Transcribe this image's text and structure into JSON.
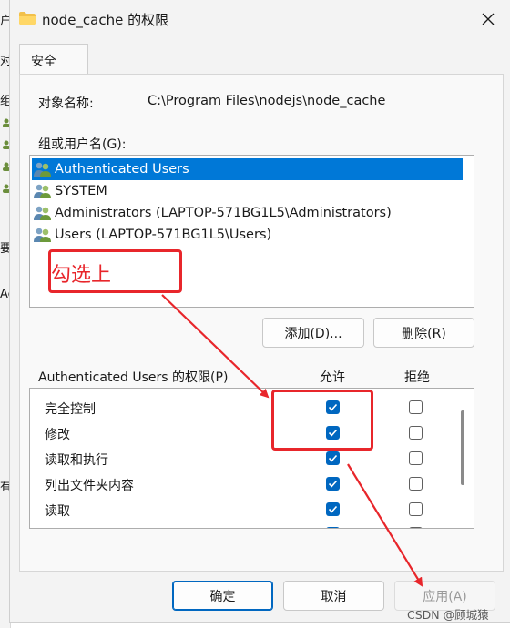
{
  "background_window": {
    "fragments": [
      "户",
      "对",
      "组",
      "要",
      "Ac",
      "有"
    ]
  },
  "window": {
    "title": "node_cache 的权限",
    "icon": "folder-icon",
    "close_icon": "close-icon"
  },
  "tab": {
    "label": "安全"
  },
  "object": {
    "label": "对象名称:",
    "value": "C:\\Program Files\\nodejs\\node_cache"
  },
  "groups": {
    "label": "组或用户名(G):",
    "items": [
      {
        "name": "Authenticated Users",
        "icon": "users-group-icon",
        "selected": true
      },
      {
        "name": "SYSTEM",
        "icon": "users-group-icon",
        "selected": false
      },
      {
        "name": "Administrators (LAPTOP-571BG1L5\\Administrators)",
        "icon": "users-group-icon",
        "selected": false
      },
      {
        "name": "Users (LAPTOP-571BG1L5\\Users)",
        "icon": "users-group-icon",
        "selected": false
      }
    ],
    "add_button": "添加(D)...",
    "remove_button": "删除(R)"
  },
  "permissions": {
    "label": "Authenticated Users 的权限(P)",
    "allow_header": "允许",
    "deny_header": "拒绝",
    "rows": [
      {
        "name": "完全控制",
        "allow": true,
        "deny": false
      },
      {
        "name": "修改",
        "allow": true,
        "deny": false
      },
      {
        "name": "读取和执行",
        "allow": true,
        "deny": false
      },
      {
        "name": "列出文件夹内容",
        "allow": true,
        "deny": false
      },
      {
        "name": "读取",
        "allow": true,
        "deny": false
      }
    ]
  },
  "footer": {
    "ok": "确定",
    "cancel": "取消",
    "apply": "应用(A)"
  },
  "annotation": {
    "text": "勾选上",
    "color": "#e8262b"
  },
  "watermark": "CSDN @顾城猿",
  "colors": {
    "selection": "#0078d7",
    "checkbox_on": "#0067c0",
    "dialog_bg": "#f3f3f3"
  }
}
